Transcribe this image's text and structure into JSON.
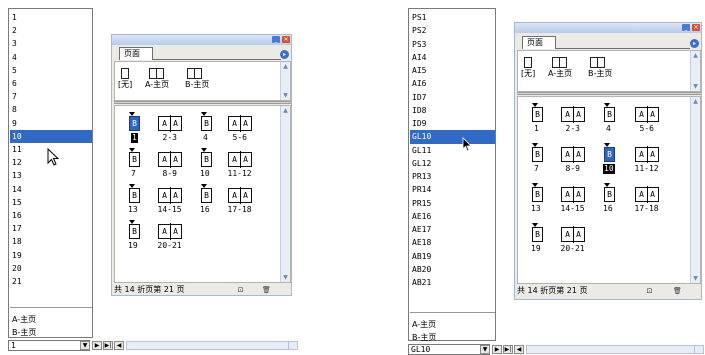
{
  "left": {
    "page_list": [
      "1",
      "2",
      "3",
      "4",
      "5",
      "6",
      "7",
      "8",
      "9",
      "10",
      "11",
      "12",
      "13",
      "14",
      "15",
      "16",
      "17",
      "18",
      "19",
      "20",
      "21"
    ],
    "selected_index": 9,
    "master_list": [
      "A-主页",
      "B-主页"
    ],
    "nav": {
      "current_value": "1",
      "dropdown_icon": "chevron-down-icon",
      "next_icon": "play-icon",
      "last_icon": "skip-end-icon",
      "prev_icon": "chevron-left-icon"
    },
    "panel": {
      "tab_label": "页面",
      "masters": [
        {
          "label": "[无]"
        },
        {
          "label": "A-主页"
        },
        {
          "label": "B-主页"
        }
      ],
      "pages": [
        {
          "kind": "single",
          "letter": "B",
          "label": "1",
          "page_selected": true,
          "label_selected": true
        },
        {
          "kind": "spread",
          "letters": [
            "A",
            "A"
          ],
          "label": "2-3"
        },
        {
          "kind": "single",
          "letter": "B",
          "label": "4"
        },
        {
          "kind": "spread",
          "letters": [
            "A",
            "A"
          ],
          "label": "5-6"
        },
        {
          "kind": "single",
          "letter": "B",
          "label": "7"
        },
        {
          "kind": "spread",
          "letters": [
            "A",
            "A"
          ],
          "label": "8-9"
        },
        {
          "kind": "single",
          "letter": "B",
          "label": "10"
        },
        {
          "kind": "spread",
          "letters": [
            "A",
            "A"
          ],
          "label": "11-12"
        },
        {
          "kind": "single",
          "letter": "B",
          "label": "13"
        },
        {
          "kind": "spread",
          "letters": [
            "A",
            "A"
          ],
          "label": "14-15"
        },
        {
          "kind": "single",
          "letter": "B",
          "label": "16"
        },
        {
          "kind": "spread",
          "letters": [
            "A",
            "A"
          ],
          "label": "17-18"
        },
        {
          "kind": "single",
          "letter": "B",
          "label": "19"
        },
        {
          "kind": "spread",
          "letters": [
            "A",
            "A"
          ],
          "label": "20-21"
        }
      ],
      "status": "共 14 折页第 21 页"
    }
  },
  "right": {
    "page_list": [
      "PS1",
      "PS2",
      "PS3",
      "AI4",
      "AI5",
      "AI6",
      "ID7",
      "ID8",
      "ID9",
      "GL10",
      "GL11",
      "GL12",
      "PR13",
      "PR14",
      "PR15",
      "AE16",
      "AE17",
      "AE18",
      "AB19",
      "AB20",
      "AB21"
    ],
    "selected_index": 9,
    "master_list": [
      "A-主页",
      "B-主页"
    ],
    "nav": {
      "current_value": "GL10",
      "dropdown_icon": "chevron-down-icon",
      "next_icon": "play-icon",
      "last_icon": "skip-end-icon",
      "prev_icon": "chevron-left-icon"
    },
    "panel": {
      "tab_label": "页面",
      "masters": [
        {
          "label": "[无]"
        },
        {
          "label": "A-主页"
        },
        {
          "label": "B-主页"
        }
      ],
      "pages": [
        {
          "kind": "single",
          "letter": "B",
          "label": "1"
        },
        {
          "kind": "spread",
          "letters": [
            "A",
            "A"
          ],
          "label": "2-3"
        },
        {
          "kind": "single",
          "letter": "B",
          "label": "4"
        },
        {
          "kind": "spread",
          "letters": [
            "A",
            "A"
          ],
          "label": "5-6"
        },
        {
          "kind": "single",
          "letter": "B",
          "label": "7"
        },
        {
          "kind": "spread",
          "letters": [
            "A",
            "A"
          ],
          "label": "8-9"
        },
        {
          "kind": "single",
          "letter": "B",
          "label": "10",
          "page_selected": true,
          "label_selected": true
        },
        {
          "kind": "spread",
          "letters": [
            "A",
            "A"
          ],
          "label": "11-12"
        },
        {
          "kind": "single",
          "letter": "B",
          "label": "13"
        },
        {
          "kind": "spread",
          "letters": [
            "A",
            "A"
          ],
          "label": "14-15"
        },
        {
          "kind": "single",
          "letter": "B",
          "label": "16"
        },
        {
          "kind": "spread",
          "letters": [
            "A",
            "A"
          ],
          "label": "17-18"
        },
        {
          "kind": "single",
          "letter": "B",
          "label": "19"
        },
        {
          "kind": "spread",
          "letters": [
            "A",
            "A"
          ],
          "label": "20-21"
        }
      ],
      "status": "共 14 折页第 21 页"
    }
  }
}
